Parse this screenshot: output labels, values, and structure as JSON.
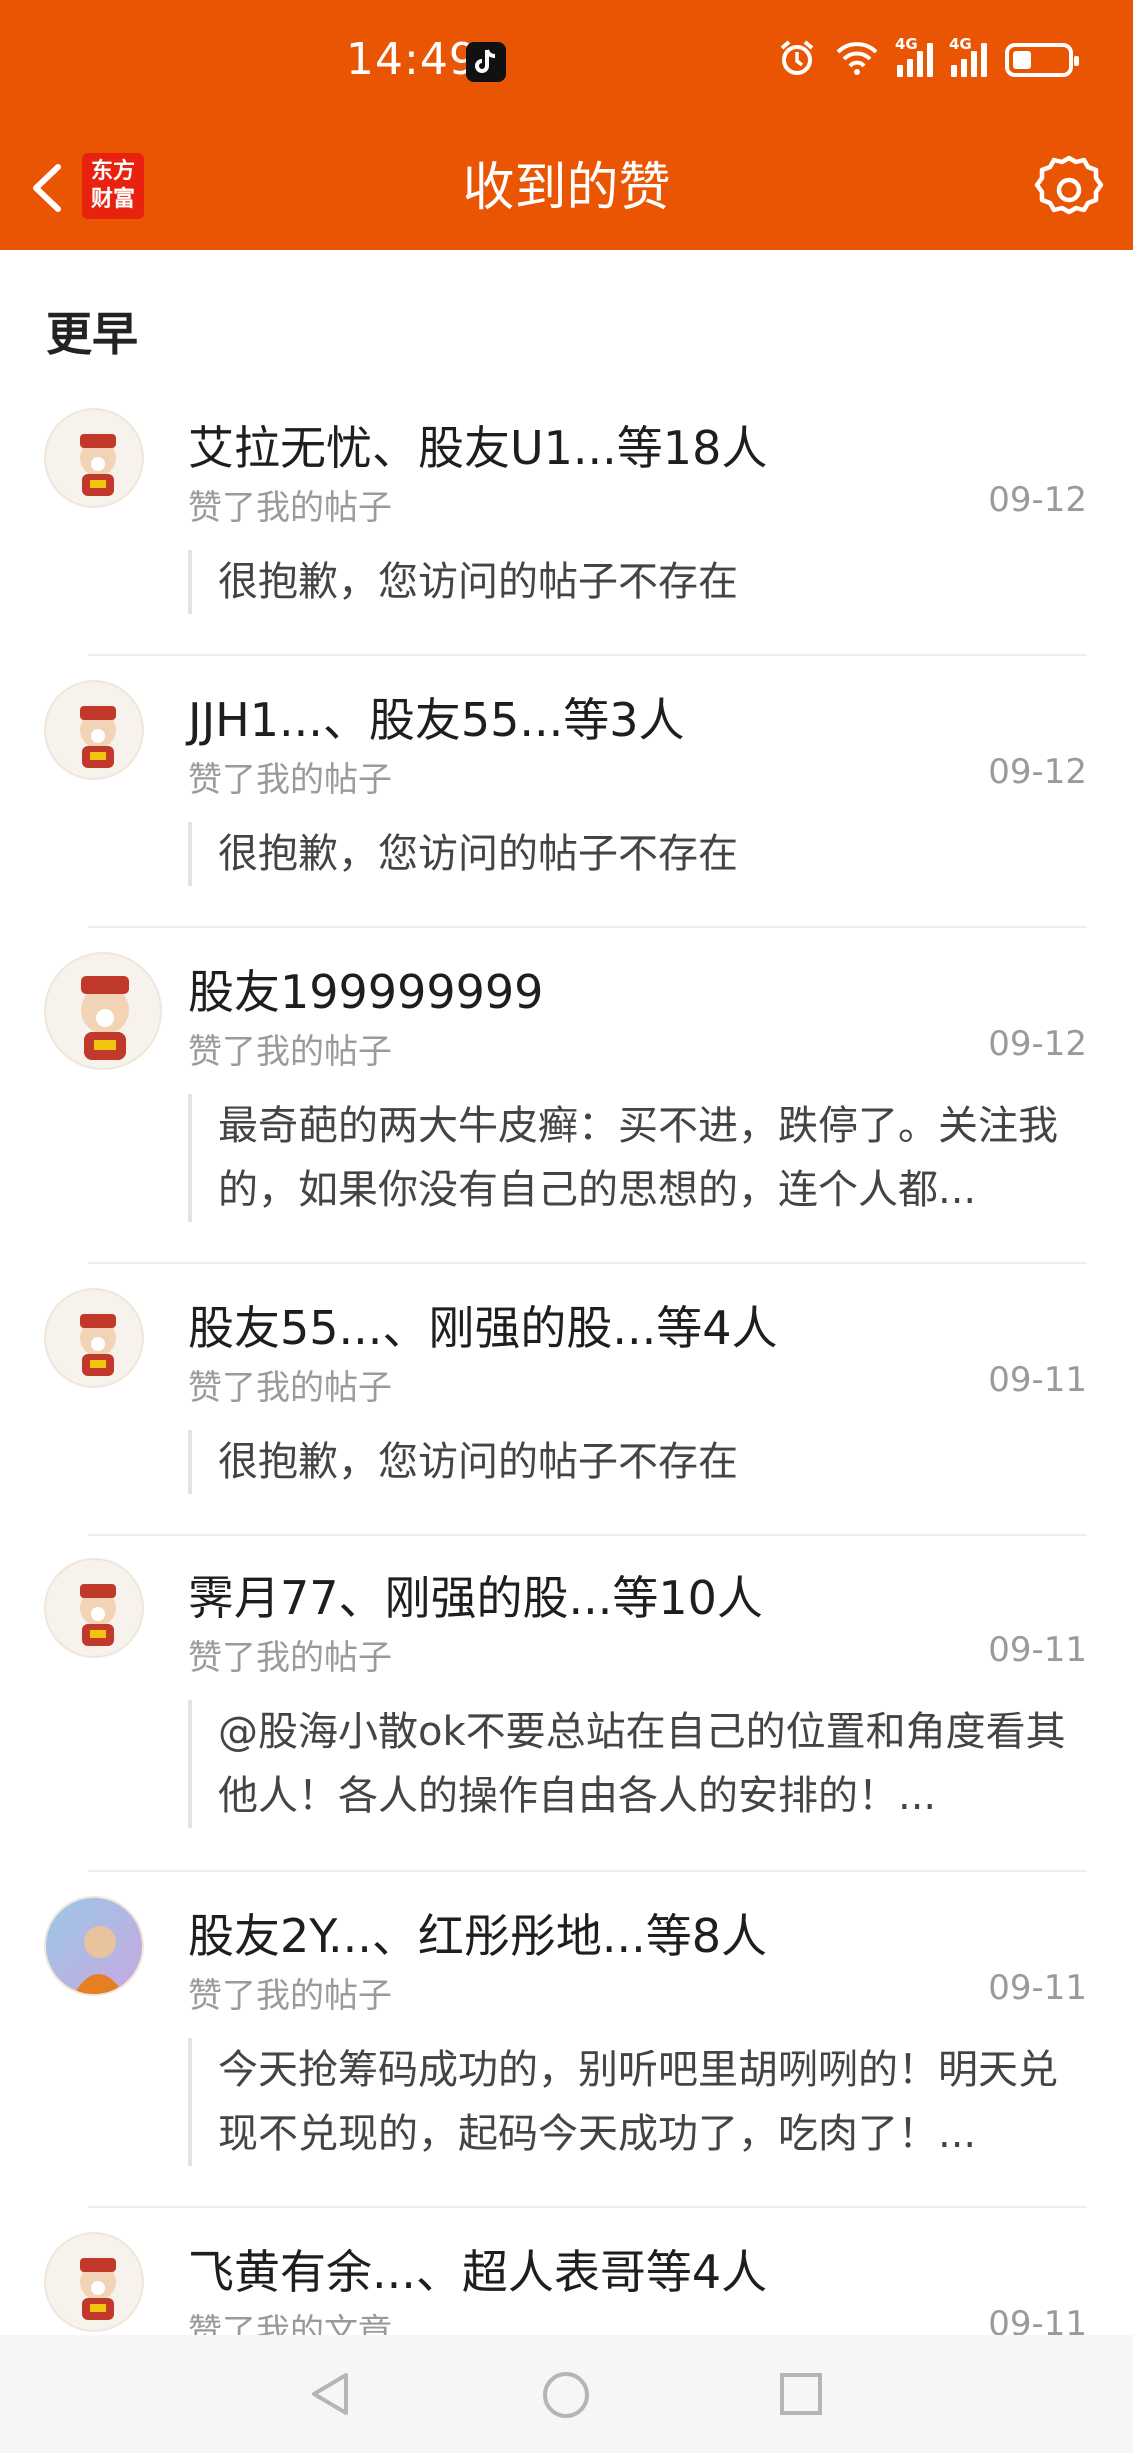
{
  "status_bar": {
    "time": "14:49",
    "net1": "4G",
    "net2": "4G"
  },
  "header": {
    "title": "收到的赞",
    "logo_line1": "东方",
    "logo_line2": "财富"
  },
  "section": {
    "title": "更早"
  },
  "items": [
    {
      "title": "艾拉无忧、股友U1...等18人",
      "subtitle": "赞了我的帖子",
      "date": "09-12",
      "quote": "很抱歉，您访问的帖子不存在"
    },
    {
      "title": "JJH1...、股友55...等3人",
      "subtitle": "赞了我的帖子",
      "date": "09-12",
      "quote": "很抱歉，您访问的帖子不存在"
    },
    {
      "title": "股友199999999",
      "subtitle": "赞了我的帖子",
      "date": "09-12",
      "quote": "最奇葩的两大牛皮癣：买不进，跌停了。关注我的，如果你没有自己的思想的，连个人都..."
    },
    {
      "title": "股友55...、刚强的股...等4人",
      "subtitle": "赞了我的帖子",
      "date": "09-11",
      "quote": "很抱歉，您访问的帖子不存在"
    },
    {
      "title": "霁月77、刚强的股...等10人",
      "subtitle": "赞了我的帖子",
      "date": "09-11",
      "quote": "@股海小散ok不要总站在自己的位置和角度看其他人！各人的操作自由各人的安排的！..."
    },
    {
      "title": "股友2Y...、红彤彤地...等8人",
      "subtitle": "赞了我的帖子",
      "date": "09-11",
      "quote": "今天抢筹码成功的，别听吧里胡咧咧的！明天兑现不兑现的，起码今天成功了，吃肉了！..."
    },
    {
      "title": "飞黄有余...、超人表哥等4人",
      "subtitle": "赞了我的文章",
      "date": "09-11",
      "quote": ""
    }
  ],
  "colors": {
    "brand": "#EA5504",
    "logo": "#E8220E"
  }
}
